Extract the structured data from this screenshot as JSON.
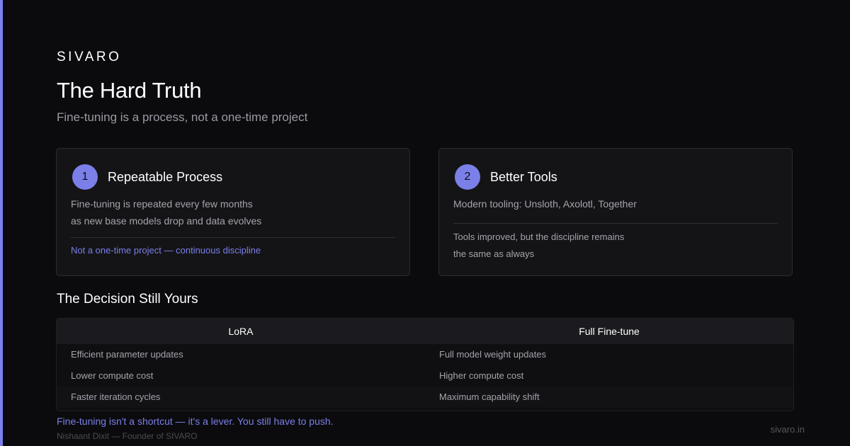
{
  "brand": "SIVARO",
  "header": {
    "title": "The Hard Truth",
    "subtitle": "Fine-tuning is a process, not a one-time project"
  },
  "cards": [
    {
      "number": "1",
      "title": "Repeatable Process",
      "lines": [
        "Fine-tuning is repeated every few months",
        "as new base models drop and data evolves"
      ],
      "note": "Not a one-time project — continuous discipline"
    },
    {
      "number": "2",
      "title": "Better Tools",
      "lines": [
        "Modern tooling: Unsloth, Axolotl, Together"
      ],
      "secondary": [
        "Tools improved, but the discipline remains",
        "the same as always"
      ]
    }
  ],
  "comparison": {
    "title": "The Decision Still Yours",
    "columns": [
      "LoRA",
      "Full Fine-tune"
    ],
    "rows": [
      [
        "Efficient parameter updates",
        "Full model weight updates"
      ],
      [
        "Lower compute cost",
        "Higher compute cost"
      ],
      [
        "Faster iteration cycles",
        "Maximum capability shift"
      ]
    ]
  },
  "footer": {
    "quote": "Fine-tuning isn't a shortcut — it's a lever. You still have to push.",
    "author": "Nishaant Dixit — Founder of SIVARO",
    "site": "sivaro.in"
  },
  "colors": {
    "background": "#0b0b0e",
    "accent": "#7b7fe8",
    "card_border": "#2c2c31",
    "muted_text": "#a3a3ab"
  }
}
